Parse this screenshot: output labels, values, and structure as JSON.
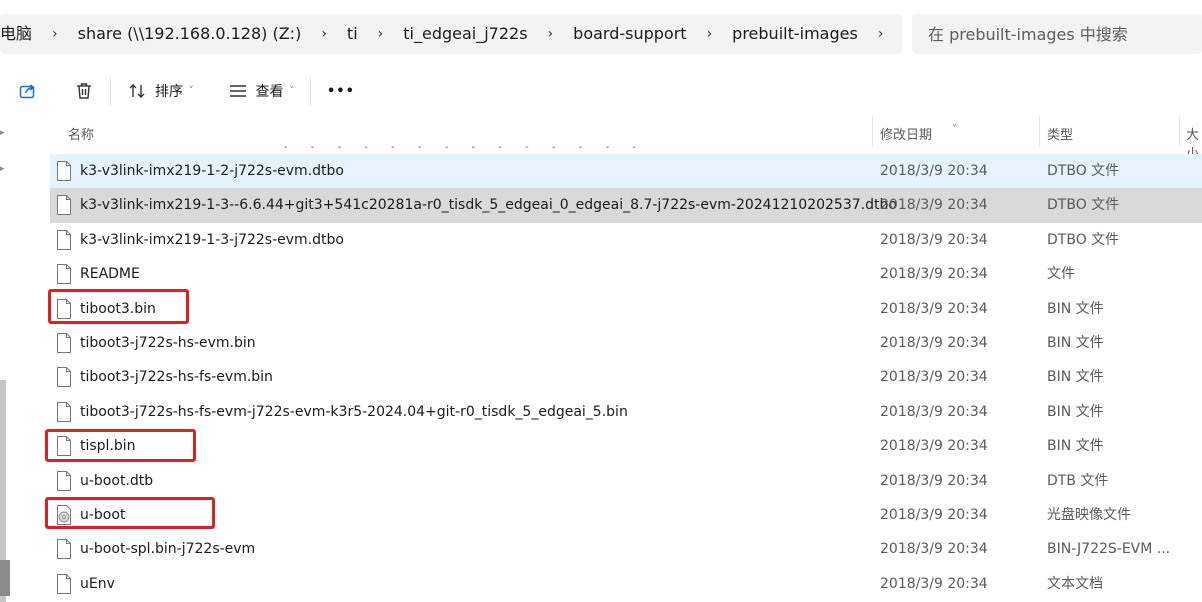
{
  "breadcrumb": [
    "电脑",
    "share (\\\\192.168.0.128) (Z:)",
    "ti",
    "ti_edgeai_j722s",
    "board-support",
    "prebuilt-images"
  ],
  "search": {
    "placeholder": "在 prebuilt-images 中搜索"
  },
  "toolbar": {
    "sort_label": "排序",
    "view_label": "查看",
    "more_label": "•••"
  },
  "columns": {
    "name": "名称",
    "date": "修改日期",
    "type": "类型",
    "size": "大小"
  },
  "colors": {
    "highlight": "#e02020",
    "hover_row": "#e5f3ff",
    "selected_row": "#d9d9d9"
  },
  "files": [
    {
      "name": "k3-v3link-imx219-1-2-j722s-evm.dtbo",
      "date": "2018/3/9 20:34",
      "type": "DTBO 文件",
      "icon": "file-icon"
    },
    {
      "name": "k3-v3link-imx219-1-3--6.6.44+git3+541c20281a-r0_tisdk_5_edgeai_0_edgeai_8.7-j722s-evm-20241210202537.dtbo",
      "date": "2018/3/9 20:34",
      "type": "DTBO 文件",
      "icon": "file-icon"
    },
    {
      "name": "k3-v3link-imx219-1-3-j722s-evm.dtbo",
      "date": "2018/3/9 20:34",
      "type": "DTBO 文件",
      "icon": "file-icon"
    },
    {
      "name": "README",
      "date": "2018/3/9 20:34",
      "type": "文件",
      "icon": "file-icon"
    },
    {
      "name": "tiboot3.bin",
      "date": "2018/3/9 20:34",
      "type": "BIN 文件",
      "icon": "file-icon"
    },
    {
      "name": "tiboot3-j722s-hs-evm.bin",
      "date": "2018/3/9 20:34",
      "type": "BIN 文件",
      "icon": "file-icon"
    },
    {
      "name": "tiboot3-j722s-hs-fs-evm.bin",
      "date": "2018/3/9 20:34",
      "type": "BIN 文件",
      "icon": "file-icon"
    },
    {
      "name": "tiboot3-j722s-hs-fs-evm-j722s-evm-k3r5-2024.04+git-r0_tisdk_5_edgeai_5.bin",
      "date": "2018/3/9 20:34",
      "type": "BIN 文件",
      "icon": "file-icon"
    },
    {
      "name": "tispl.bin",
      "date": "2018/3/9 20:34",
      "type": "BIN 文件",
      "icon": "file-icon"
    },
    {
      "name": "u-boot.dtb",
      "date": "2018/3/9 20:34",
      "type": "DTB 文件",
      "icon": "file-icon"
    },
    {
      "name": "u-boot",
      "date": "2018/3/9 20:34",
      "type": "光盘映像文件",
      "icon": "disc-image-icon"
    },
    {
      "name": "u-boot-spl.bin-j722s-evm",
      "date": "2018/3/9 20:34",
      "type": "BIN-J722S-EVM ...",
      "icon": "file-icon"
    },
    {
      "name": "uEnv",
      "date": "2018/3/9 20:34",
      "type": "文本文档",
      "icon": "file-icon"
    }
  ]
}
